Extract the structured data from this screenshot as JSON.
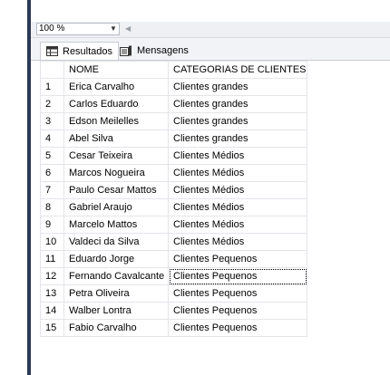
{
  "toolbar": {
    "zoom_value": "100 %"
  },
  "tabs": [
    {
      "label": "Resultados",
      "icon": "grid-icon",
      "active": true
    },
    {
      "label": "Mensagens",
      "icon": "messages-icon",
      "active": false
    }
  ],
  "grid": {
    "columns": [
      "",
      "NOME",
      "CATEGORIAS DE CLIENTES"
    ],
    "rows": [
      {
        "n": "1",
        "nome": "Erica Carvalho",
        "categoria": "Clientes grandes"
      },
      {
        "n": "2",
        "nome": "Carlos Eduardo",
        "categoria": "Clientes grandes"
      },
      {
        "n": "3",
        "nome": "Edson Meilelles",
        "categoria": "Clientes grandes"
      },
      {
        "n": "4",
        "nome": "Abel Silva",
        "categoria": "Clientes grandes"
      },
      {
        "n": "5",
        "nome": "Cesar Teixeira",
        "categoria": "Clientes Médios"
      },
      {
        "n": "6",
        "nome": "Marcos Nogueira",
        "categoria": "Clientes Médios"
      },
      {
        "n": "7",
        "nome": "Paulo Cesar Mattos",
        "categoria": "Clientes Médios"
      },
      {
        "n": "8",
        "nome": "Gabriel Araujo",
        "categoria": "Clientes Médios"
      },
      {
        "n": "9",
        "nome": "Marcelo Mattos",
        "categoria": "Clientes Médios"
      },
      {
        "n": "10",
        "nome": "Valdeci da Silva",
        "categoria": "Clientes Médios"
      },
      {
        "n": "11",
        "nome": "Eduardo Jorge",
        "categoria": "Clientes Pequenos"
      },
      {
        "n": "12",
        "nome": "Fernando Cavalcante",
        "categoria": "Clientes Pequenos"
      },
      {
        "n": "13",
        "nome": "Petra Oliveira",
        "categoria": "Clientes Pequenos"
      },
      {
        "n": "14",
        "nome": "Walber Lontra",
        "categoria": "Clientes Pequenos"
      },
      {
        "n": "15",
        "nome": "Fabio Carvalho",
        "categoria": "Clientes Pequenos"
      }
    ],
    "selected_row": 12
  },
  "colors": {
    "side_bar": "#2b3a55",
    "grid_line": "#e3e5ea"
  }
}
